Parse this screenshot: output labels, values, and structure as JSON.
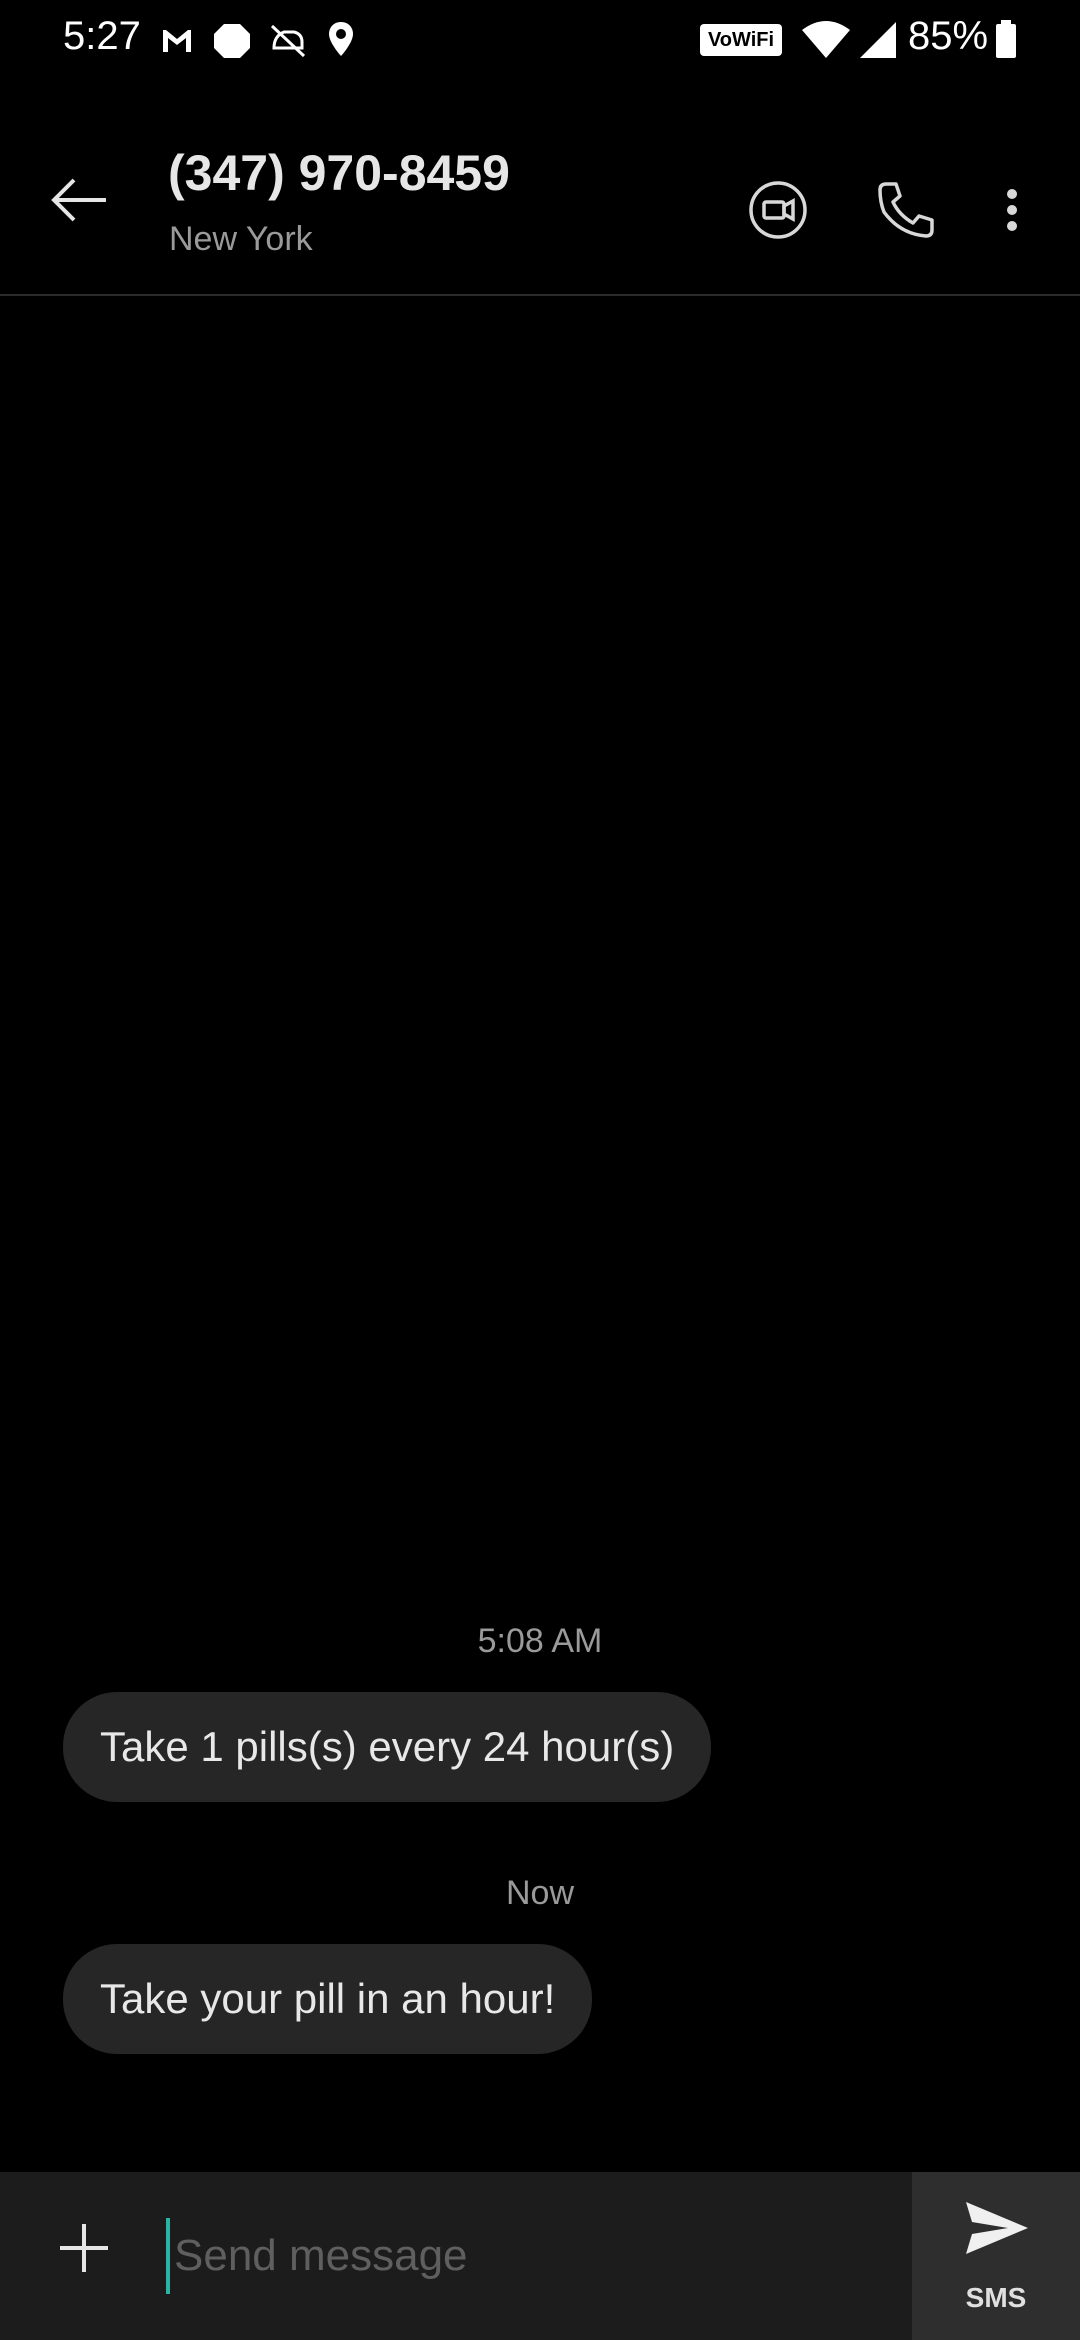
{
  "status_bar": {
    "time": "5:27",
    "vowifi_label": "VoWiFi",
    "battery_percent": "85%",
    "icons": [
      "gmail-icon",
      "app-notification-icon",
      "sync-off-icon",
      "location-icon",
      "wifi-icon",
      "signal-icon",
      "battery-icon"
    ]
  },
  "header": {
    "contact_name": "(347) 970-8459",
    "contact_location": "New York"
  },
  "conversation": {
    "groups": [
      {
        "timestamp": "5:08 AM",
        "message": "Take 1 pills(s) every 24 hour(s)"
      },
      {
        "timestamp": "Now",
        "message": "Take your pill in an hour!"
      }
    ]
  },
  "composer": {
    "placeholder": "Send message",
    "value": "",
    "send_label": "SMS"
  },
  "colors": {
    "background": "#000000",
    "bubble": "#262626",
    "composer": "#1c1c1c",
    "accent_cursor": "#2bb3a6"
  }
}
